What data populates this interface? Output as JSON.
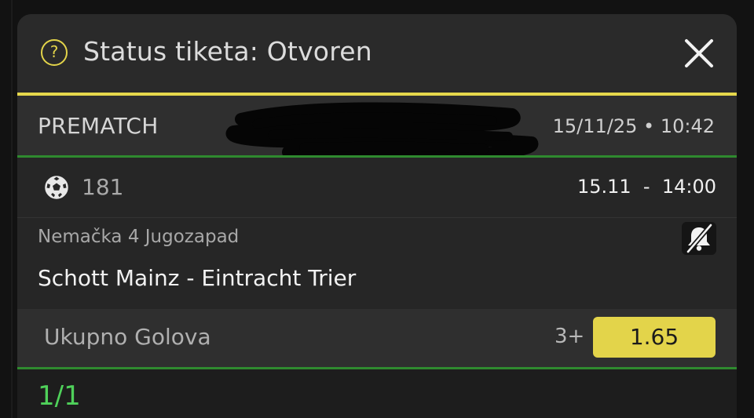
{
  "header": {
    "title": "Status tiketa: Otvoren",
    "help_icon": "question-circle-icon",
    "close_icon": "close-icon",
    "accent_color": "#e6d84c"
  },
  "ticket": {
    "type_label": "PREMATCH",
    "datetime": "15/11/25 • 10:42"
  },
  "event": {
    "sport_icon": "soccer-ball-icon",
    "code": "181",
    "time": "15.11  -  14:00",
    "league": "Nemačka 4 Jugozapad",
    "notification_icon": "bell-off-icon",
    "match": "Schott Mainz - Eintracht Trier"
  },
  "bet": {
    "market": "Ukupno Golova",
    "selection": "3+",
    "odds": "1.65",
    "odds_color": "#e3d44a"
  },
  "footer": {
    "count": "1/1",
    "count_color": "#4fd15a"
  }
}
